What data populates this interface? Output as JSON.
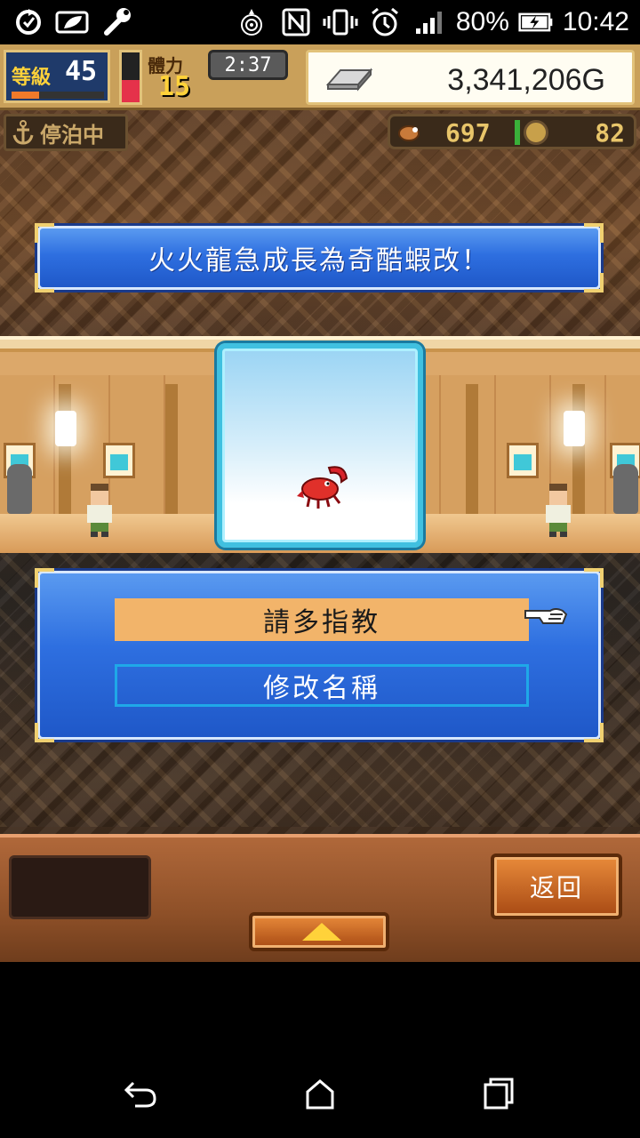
{
  "status_bar": {
    "battery_percent": "80%",
    "time": "10:42",
    "icons": [
      "sync-icon",
      "leaf-icon",
      "wrench-icon",
      "fingerprint-icon",
      "nfc-icon",
      "vibrate-icon",
      "alarm-icon",
      "signal-icon",
      "battery-charging-icon"
    ]
  },
  "hud": {
    "level_label": "等級",
    "level_value": "45",
    "level_progress": 0.3,
    "stamina_label": "體力",
    "stamina_value": "15",
    "stamina_fill": 0.45,
    "timer": "2:37",
    "gold": "3,341,206G",
    "dock_status": "停泊中",
    "resource1": "697",
    "resource2": "82"
  },
  "message": {
    "text": "火火龍急成長為奇酷蝦改！"
  },
  "menu": {
    "options": [
      {
        "label": "請多指教",
        "selected": true
      },
      {
        "label": "修改名稱",
        "selected": false
      }
    ]
  },
  "bottom_bar": {
    "back_label": "返回"
  },
  "colors": {
    "panel_blue": "#2e6fe0",
    "selected_option": "#f2b46a",
    "gold_accent": "#ffd23a"
  }
}
